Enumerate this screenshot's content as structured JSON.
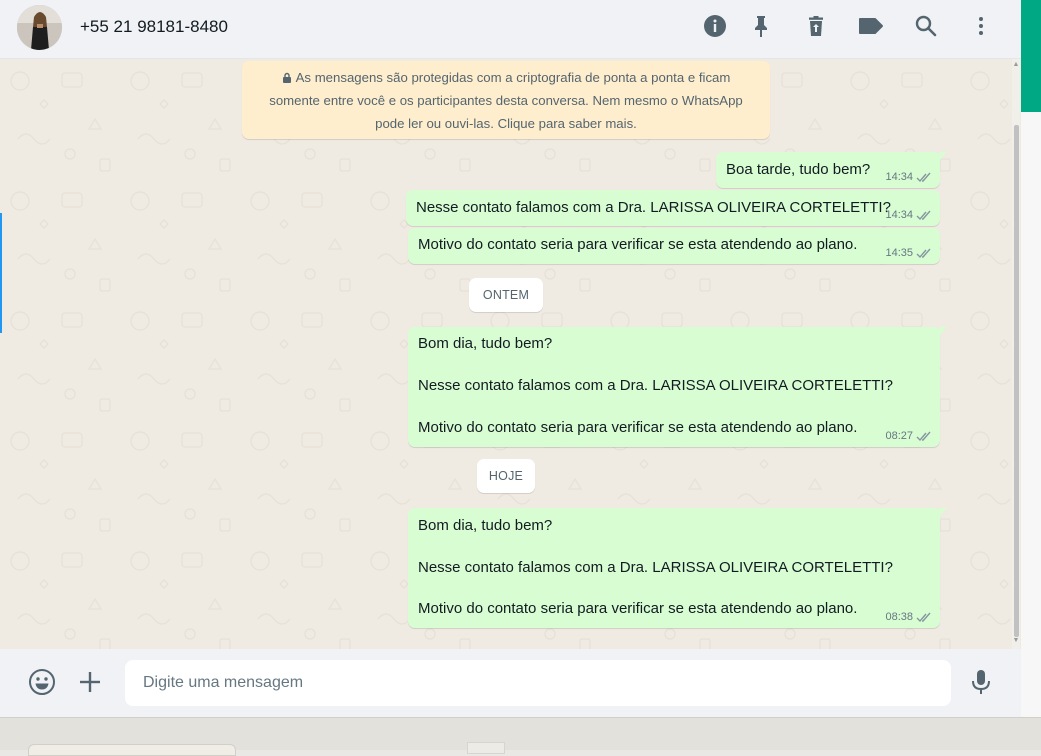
{
  "header": {
    "contact_name": "+55 21 98181-8480"
  },
  "icons": {
    "info": "info-icon",
    "pin": "pin-icon",
    "delete": "delete-icon",
    "label": "label-icon",
    "search": "search-icon",
    "menu": "more-options-icon",
    "emoji": "emoji-icon",
    "attach": "plus-icon",
    "mic": "microphone-icon"
  },
  "colors": {
    "header_bg": "#f0f2f5",
    "chat_bg": "#efeae2",
    "outgoing_bubble": "#d9fdd3",
    "notice_bg": "#ffeecd",
    "accent": "#00a884",
    "read_ticks": "#8696a0"
  },
  "encryption_notice": {
    "line1": "As mensagens são protegidas com a criptografia de ponta a ponta e ficam",
    "line2": "somente entre você e os participantes desta conversa. Nem mesmo o WhatsApp",
    "line3": "pode ler ou ouvi-las. Clique para saber mais."
  },
  "messages": [
    {
      "lines": [
        "Boa tarde, tudo bem?"
      ],
      "time": "14:34"
    },
    {
      "lines": [
        "Nesse contato falamos com a Dra. LARISSA OLIVEIRA CORTELETTI?"
      ],
      "time": "14:34"
    },
    {
      "lines": [
        "Motivo do contato seria para verificar se esta atendendo ao plano."
      ],
      "time": "14:35"
    },
    {
      "lines": [
        "Bom dia, tudo bem?",
        "Nesse contato falamos com a Dra. LARISSA OLIVEIRA CORTELETTI?",
        "Motivo do contato seria para verificar se esta atendendo ao plano."
      ],
      "time": "08:27"
    },
    {
      "lines": [
        "Bom dia, tudo bem?",
        "Nesse contato falamos com a Dra. LARISSA OLIVEIRA CORTELETTI?",
        "Motivo do contato seria para verificar se esta atendendo ao plano."
      ],
      "time": "08:38"
    }
  ],
  "date_separators": {
    "yesterday": "ONTEM",
    "today": "HOJE"
  },
  "composer": {
    "placeholder": "Digite uma mensagem"
  }
}
